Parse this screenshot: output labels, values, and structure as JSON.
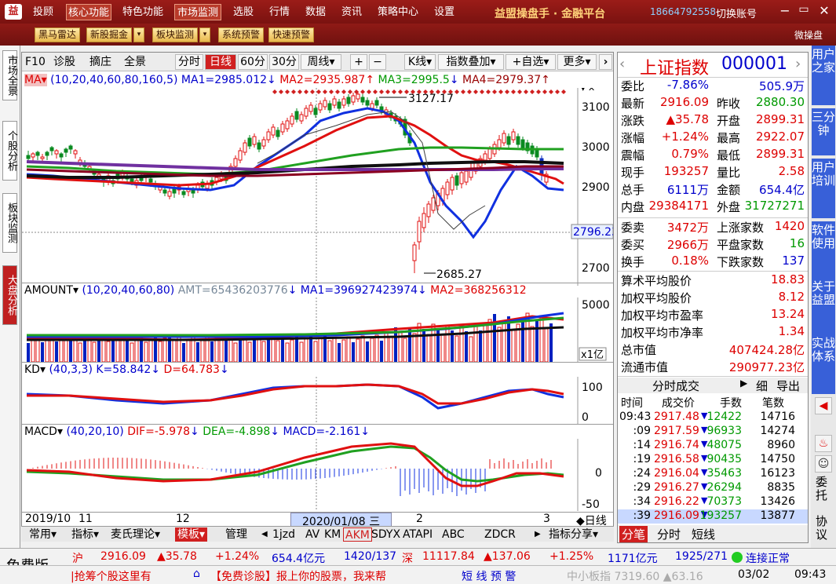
{
  "app": {
    "logo_icon": "brand-logo-icon",
    "title": "益盟操盘手 · 金融平台",
    "phone": "18664792558",
    "switch_account": "切换账号",
    "micro_label": "微操盘"
  },
  "menu": {
    "items": [
      "投顾",
      "核心功能",
      "特色功能",
      "市场监测",
      "选股",
      "行情",
      "数据",
      "资讯",
      "策略中心",
      "设置"
    ],
    "active": [
      "核心功能",
      "市场监测"
    ]
  },
  "toolbar2": {
    "buttons": [
      "黑马雷达",
      "新股掘金",
      "板块监测",
      "系统预警",
      "快速预警"
    ]
  },
  "leftbar": {
    "tabs": [
      "市场全景",
      "个股分析",
      "板块监测",
      "大盘分析"
    ]
  },
  "chart_toolbar": {
    "items": [
      "F10",
      "诊股",
      "摘庄",
      "全景",
      "分时",
      "日线",
      "60分",
      "30分",
      "周线▾",
      "+",
      "−",
      "K线▾",
      "指数叠加▾",
      "+自选▾",
      "更多▾"
    ],
    "active": "日线"
  },
  "indicators": {
    "ma": {
      "name": "MA▾",
      "params": "(10,20,40,60,80,160,5)",
      "ma1": "MA1=2985.012",
      "ma2": "MA2=2935.987",
      "ma3": "MA3=2995.5",
      "ma4": "MA4=2979.37",
      "high_label": "3127.17",
      "low_label": "2685.27",
      "ticks": [
        "3100",
        "3000",
        "2900",
        "2800",
        "2700"
      ],
      "cursor_value": "2796.23"
    },
    "amount": {
      "name": "AMOUNT▾",
      "params": "(10,20,40,60,80)",
      "amt": "AMT=65436203776",
      "ma1": "MA1=396927423974",
      "ma2": "MA2=368256312",
      "ticks": [
        "5000",
        "x1亿"
      ]
    },
    "kd": {
      "name": "KD▾",
      "params": "(40,3,3)",
      "k": "K=58.842",
      "d": "D=64.783",
      "ticks": [
        "100",
        "0"
      ]
    },
    "macd": {
      "name": "MACD▾",
      "params": "(40,20,10)",
      "dif": "DIF=-5.978",
      "dea": "DEA=-4.898",
      "macd": "MACD=-2.161",
      "ticks": [
        "0",
        "-50"
      ]
    }
  },
  "time_axis": {
    "labels": [
      "2019/10",
      "11",
      "12",
      "2020/01/08 三",
      "2",
      "3"
    ],
    "period": "◆日线"
  },
  "bottom_tabs": {
    "items": [
      "常用▾",
      "指标▾",
      "麦氏理论▾",
      "模板▾",
      "管理",
      "1jzd",
      "AV",
      "KM",
      "AKM",
      "SDYX",
      "ATAPI",
      "ABC",
      "ZDCR",
      "指标分享▾"
    ],
    "active": [
      "模板",
      "AKM"
    ]
  },
  "quote": {
    "name": "上证指数",
    "code": "000001",
    "rows": [
      [
        "委比",
        "-7.86%",
        "",
        "505.9万"
      ],
      [
        "最新",
        "2916.09",
        "昨收",
        "2880.30"
      ],
      [
        "涨跌",
        "▲35.78",
        "开盘",
        "2899.31"
      ],
      [
        "涨幅",
        "+1.24%",
        "最高",
        "2922.07"
      ],
      [
        "震幅",
        "0.79%",
        "最低",
        "2899.31"
      ],
      [
        "现手",
        "193257",
        "量比",
        "2.58"
      ],
      [
        "总手",
        "6111万",
        "金额",
        "654.4亿"
      ],
      [
        "内盘",
        "29384171",
        "外盘",
        "31727271"
      ]
    ],
    "rows2": [
      [
        "委卖",
        "3472万",
        "上涨家数",
        "1420"
      ],
      [
        "委买",
        "2966万",
        "平盘家数",
        "16"
      ],
      [
        "换手",
        "0.18%",
        "下跌家数",
        "137"
      ]
    ],
    "rows3": [
      [
        "算术平均股价",
        "18.83"
      ],
      [
        "加权平均股价",
        "8.12"
      ],
      [
        "加权平均市盈率",
        "13.24"
      ],
      [
        "加权平均市净率",
        "1.34"
      ],
      [
        "总市值",
        "407424.28亿"
      ],
      [
        "流通市值",
        "290977.23亿"
      ]
    ]
  },
  "ticks_panel": {
    "title": "分时成交",
    "tabs": [
      "细",
      "导出"
    ],
    "headers": [
      "时间",
      "成交价",
      "手数",
      "笔数"
    ],
    "rows": [
      [
        "09:43",
        "2917.48",
        "12422",
        "14716"
      ],
      [
        ":09",
        "2917.59",
        "96933",
        "14274"
      ],
      [
        ":14",
        "2916.74",
        "48075",
        "8960"
      ],
      [
        ":19",
        "2916.58",
        "90435",
        "14750"
      ],
      [
        ":24",
        "2916.04",
        "35463",
        "16123"
      ],
      [
        ":29",
        "2916.27",
        "26294",
        "8835"
      ],
      [
        ":34",
        "2916.22",
        "70373",
        "13426"
      ],
      [
        ":39",
        "2916.09",
        "193257",
        "13877"
      ]
    ],
    "bottom_tabs": [
      "分笔",
      "分时",
      "短线"
    ]
  },
  "farright": {
    "tabs": [
      "用户之家",
      "三分钟",
      "用户培训",
      "软件使用",
      "关于益盟",
      "实战体系"
    ],
    "icons": [
      "nav-icon",
      "alarm-icon",
      "user-icon",
      "broker-icon"
    ],
    "labels": [
      "委托",
      "协议"
    ]
  },
  "status1": {
    "free": "免费版",
    "sh": "沪",
    "sh_price": "2916.09",
    "sh_chg": "▲35.78",
    "sh_pct": "+1.24%",
    "sh_amt": "654.4亿元",
    "sh_updown": "1420/137",
    "sz": "深",
    "sz_price": "11117.84",
    "sz_chg": "▲137.06",
    "sz_pct": "+1.25%",
    "sz_amt": "1171亿元",
    "sz_updown": "1925/271",
    "conn": "连接正常"
  },
  "status2": {
    "ticker": "|抢筹个股这里有",
    "promo": "【免费诊股】报上你的股票，我来帮",
    "warn": "短 线 预 警",
    "small": "中小板指 7319.60 ▲63.16",
    "date": "03/02",
    "time": "09:43"
  },
  "colors": {
    "up": "#dd0000",
    "down": "#009900",
    "accent": "#9b1c18",
    "blue": "#3860d8"
  }
}
